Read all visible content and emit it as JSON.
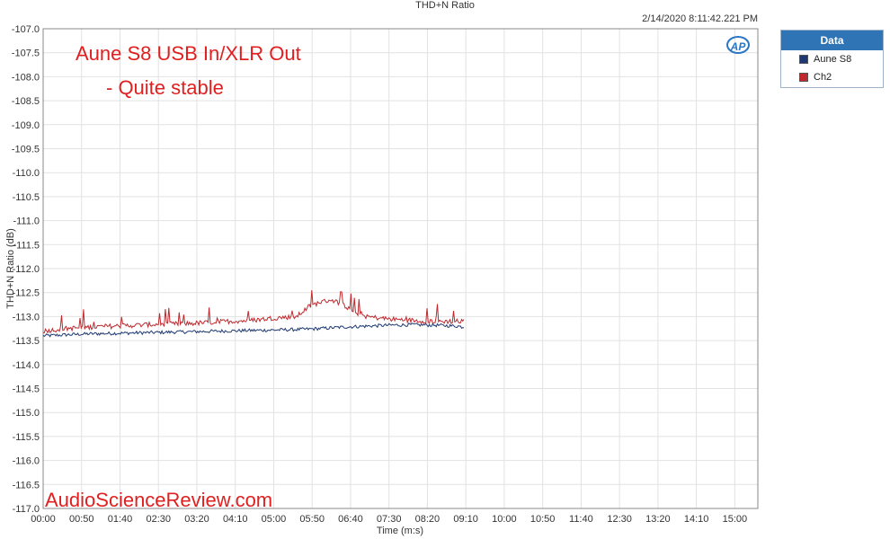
{
  "chart_data": {
    "type": "line",
    "title": "THD+N Ratio",
    "timestamp": "2/14/2020 8:11:42.221 PM",
    "annotation_line1": "Aune S8 USB In/XLR Out",
    "annotation_line2": "- Quite stable",
    "watermark": "AudioScienceReview.com",
    "logo_text": "AP",
    "xlabel": "Time (m:s)",
    "ylabel": "THD+N Ratio (dB)",
    "xlim_seconds": [
      0,
      930
    ],
    "ylim": [
      -117.0,
      -107.0
    ],
    "x_tick_labels": [
      "00:00",
      "00:50",
      "01:40",
      "02:30",
      "03:20",
      "04:10",
      "05:00",
      "05:50",
      "06:40",
      "07:30",
      "08:20",
      "09:10",
      "10:00",
      "10:50",
      "11:40",
      "12:30",
      "13:20",
      "14:10",
      "15:00"
    ],
    "y_tick_labels": [
      "-107.0",
      "-107.5",
      "-108.0",
      "-108.5",
      "-109.0",
      "-109.5",
      "-110.0",
      "-110.5",
      "-111.0",
      "-111.5",
      "-112.0",
      "-112.5",
      "-113.0",
      "-113.5",
      "-114.0",
      "-114.5",
      "-115.0",
      "-115.5",
      "-116.0",
      "-116.5",
      "-117.0"
    ],
    "grid": true,
    "legend": {
      "title": "Data",
      "position": "top-right"
    },
    "series": [
      {
        "name": "Aune S8",
        "color": "#1f3a73",
        "points": [
          [
            0,
            -113.4
          ],
          [
            30,
            -113.38
          ],
          [
            60,
            -113.36
          ],
          [
            90,
            -113.35
          ],
          [
            120,
            -113.34
          ],
          [
            150,
            -113.33
          ],
          [
            180,
            -113.32
          ],
          [
            210,
            -113.31
          ],
          [
            240,
            -113.3
          ],
          [
            270,
            -113.29
          ],
          [
            300,
            -113.28
          ],
          [
            330,
            -113.27
          ],
          [
            360,
            -113.25
          ],
          [
            390,
            -113.22
          ],
          [
            420,
            -113.2
          ],
          [
            450,
            -113.18
          ],
          [
            480,
            -113.17
          ],
          [
            510,
            -113.18
          ],
          [
            540,
            -113.2
          ],
          [
            548,
            -113.22
          ]
        ]
      },
      {
        "name": "Ch2",
        "color": "#c0282d",
        "points": [
          [
            0,
            -113.3
          ],
          [
            30,
            -113.25
          ],
          [
            60,
            -113.22
          ],
          [
            90,
            -113.2
          ],
          [
            120,
            -113.18
          ],
          [
            150,
            -113.16
          ],
          [
            180,
            -113.15
          ],
          [
            210,
            -113.13
          ],
          [
            240,
            -113.1
          ],
          [
            270,
            -113.08
          ],
          [
            300,
            -113.03
          ],
          [
            330,
            -113.0
          ],
          [
            345,
            -112.8
          ],
          [
            360,
            -112.7
          ],
          [
            375,
            -112.65
          ],
          [
            390,
            -112.75
          ],
          [
            405,
            -112.9
          ],
          [
            420,
            -113.0
          ],
          [
            450,
            -113.05
          ],
          [
            480,
            -113.08
          ],
          [
            510,
            -113.1
          ],
          [
            540,
            -113.1
          ],
          [
            548,
            -113.1
          ]
        ]
      }
    ]
  }
}
